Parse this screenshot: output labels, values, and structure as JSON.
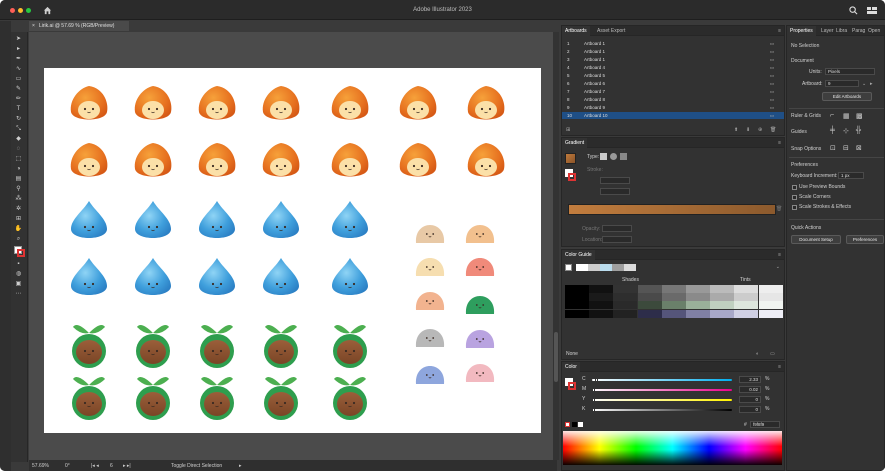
{
  "app": {
    "title": "Adobe Illustrator 2023"
  },
  "document": {
    "tab_label": "Lirik.ai @ 57.69 % (RGB/Preview)",
    "close_glyph": "×"
  },
  "colors": {
    "accent": "#2d6db4",
    "panel_bg": "#323232",
    "selected_row": "#1f4f86"
  },
  "artboards_panel": {
    "tabs": [
      "Artboards",
      "Asset Export"
    ],
    "items": [
      {
        "num": "1",
        "name": "Artboard 1"
      },
      {
        "num": "2",
        "name": "Artboard 1"
      },
      {
        "num": "3",
        "name": "Artboard 1"
      },
      {
        "num": "4",
        "name": "Artboard 4"
      },
      {
        "num": "5",
        "name": "Artboard 5"
      },
      {
        "num": "6",
        "name": "Artboard 6"
      },
      {
        "num": "7",
        "name": "Artboard 7"
      },
      {
        "num": "8",
        "name": "Artboard 8"
      },
      {
        "num": "9",
        "name": "Artboard 9"
      },
      {
        "num": "10",
        "name": "Artboard 10"
      }
    ]
  },
  "gradient_panel": {
    "title": "Gradient",
    "type_label": "Type:",
    "stroke_label": "Stroke:",
    "opacity_label": "Opacity:",
    "location_label": "Location:"
  },
  "color_guide_panel": {
    "title": "Color Guide",
    "shades_label": "Shades",
    "tints_label": "Tints",
    "none_label": "None"
  },
  "color_panel": {
    "title": "Color",
    "channels": [
      {
        "name": "C",
        "value": "2.33",
        "pct": 2.33
      },
      {
        "name": "M",
        "value": "0.02",
        "pct": 0.02
      },
      {
        "name": "Y",
        "value": "0",
        "pct": 0
      },
      {
        "name": "K",
        "value": "0",
        "pct": 0
      }
    ],
    "hex_value": "f9f8f9"
  },
  "properties_panel": {
    "tabs": [
      "Properties",
      "Layer",
      "Libra",
      "Parag",
      "Open"
    ],
    "selection": "No Selection",
    "document_header": "Document",
    "units_label": "Units:",
    "units_value": "Pixels",
    "artboard_label": "Artboard:",
    "artboard_value": "9",
    "edit_artboards": "Edit Artboards",
    "ruler_grids": "Ruler & Grids",
    "guides": "Guides",
    "snap_options": "Snap Options",
    "preferences_header": "Preferences",
    "keyboard_increment_label": "Keyboard Increment:",
    "keyboard_increment_value": "1 px",
    "use_preview_bounds": "Use Preview Bounds",
    "scale_corners": "Scale Corners",
    "scale_strokes": "Scale Strokes & Effects",
    "quick_actions": "Quick Actions",
    "document_setup": "Document Setup",
    "preferences_button": "Preferences"
  },
  "status_bar": {
    "zoom": "57.69%",
    "rotation": "0°",
    "artboard_nav": "6",
    "tool_label": "Toggle Direct Selection"
  },
  "icons": {
    "home": "home-icon",
    "search": "search-icon",
    "workspace": "workspace-icon",
    "menu": "hamburger-icon"
  }
}
